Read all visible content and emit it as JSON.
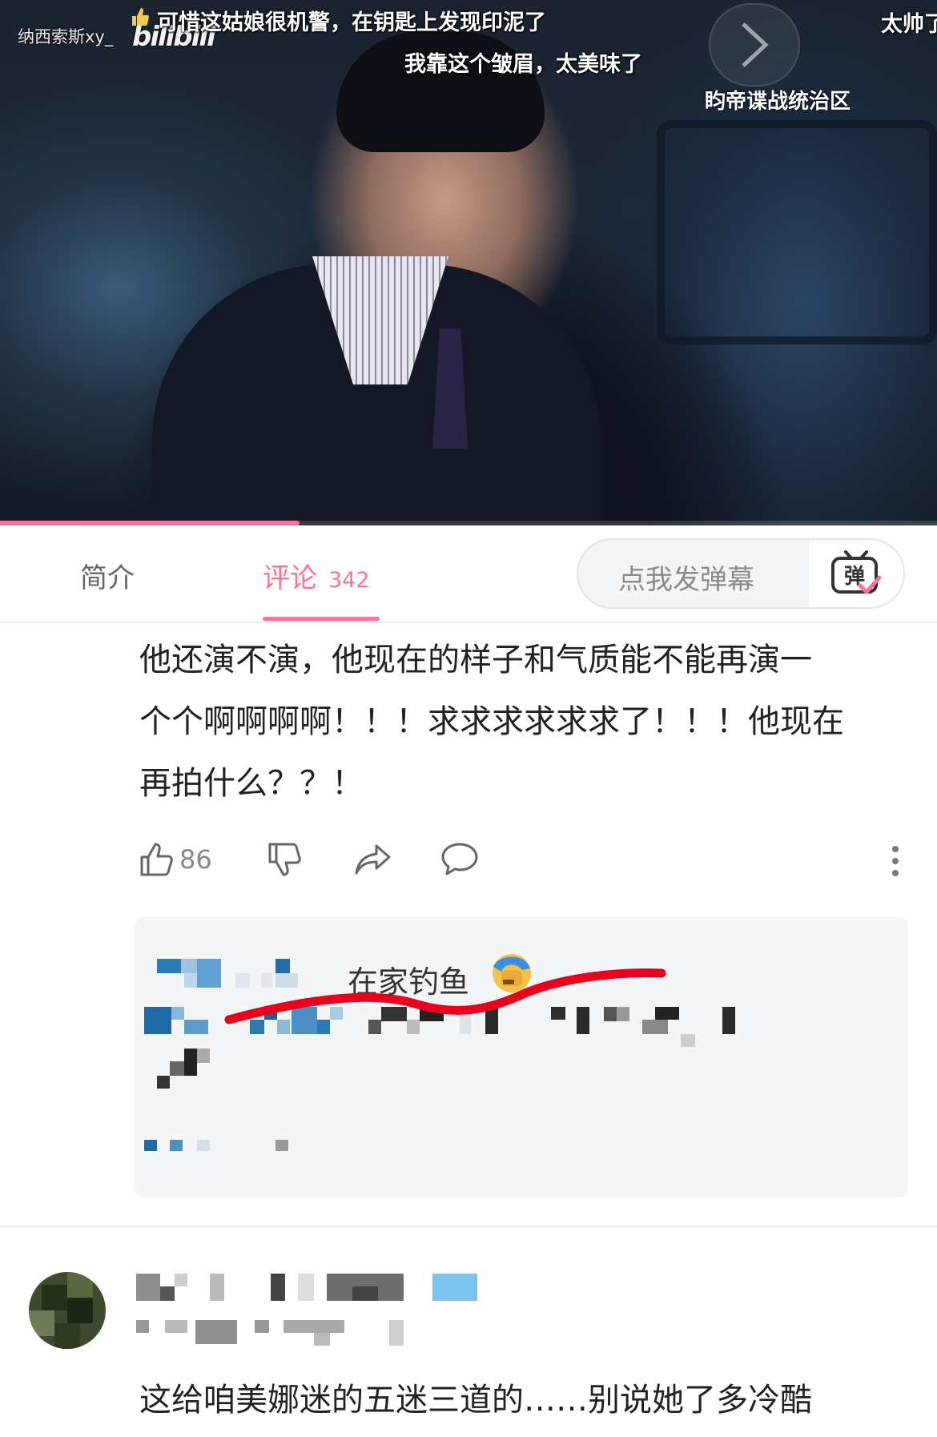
{
  "video": {
    "uploader": "纳西索斯xy_",
    "logo": "bilibili",
    "danmaku": [
      "可惜这姑娘很机警，在钥匙上发现印泥了",
      "我靠这个皱眉，太美味了",
      "太帅了"
    ],
    "next_label": "盷帝谍战统治区",
    "progress_fraction": 0.32
  },
  "tabs": {
    "intro": "简介",
    "comments": "评论",
    "comment_count": "342",
    "danmaku_placeholder": "点我发弹幕",
    "danmaku_toggle_label": "弹"
  },
  "comment1": {
    "text_lines": [
      "他还演不演，他现在的样子和气质能不能再演一",
      "个个啊啊啊啊！！！求求求求求求了！！！他现在",
      "再拍什么？？！"
    ],
    "likes": "86",
    "icons": [
      "thumb-up-icon",
      "thumb-down-icon",
      "share-icon",
      "reply-icon",
      "more-icon"
    ]
  },
  "reply": {
    "name_suffix": "在家钓鱼"
  },
  "comment2": {
    "text": "这给咱美娜迷的五迷三道的……别说她了多冷酷"
  },
  "colors": {
    "accent": "#fb7299",
    "annotation": "#e8001c"
  }
}
